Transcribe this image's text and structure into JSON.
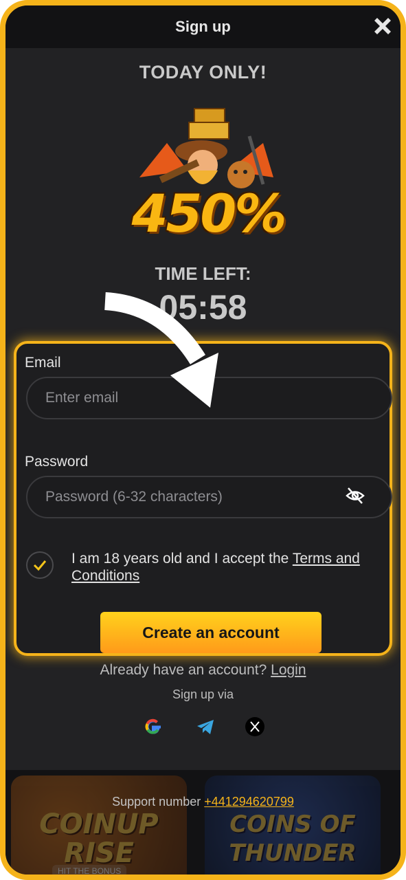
{
  "header": {
    "title": "Sign up",
    "close_icon": "close-icon"
  },
  "promo": {
    "headline": "TODAY ONLY!",
    "bonus_percent": "450%",
    "time_left_label": "TIME LEFT:",
    "countdown": "05:58"
  },
  "form": {
    "email_label": "Email",
    "email_placeholder": "Enter email",
    "password_label": "Password",
    "password_placeholder": "Password (6-32 characters)",
    "password_toggle_icon": "eye-off-icon",
    "agree_checked": true,
    "terms_prefix": "I am 18 years old and I accept the ",
    "terms_link": "Terms and Conditions",
    "create_button": "Create an account"
  },
  "login": {
    "prefix": "Already have an account? ",
    "link": "Login"
  },
  "signup_via": {
    "label": "Sign up via",
    "providers": [
      "google-icon",
      "telegram-icon",
      "x-icon"
    ]
  },
  "footer": {
    "games": [
      {
        "title": "COINUP RISE",
        "subtitle": "HIT THE BONUS"
      },
      {
        "title": "COINS OF THUNDER",
        "subtitle": ""
      }
    ],
    "support_prefix": "Support number ",
    "support_number": "+441294620799"
  },
  "colors": {
    "accent": "#f5b31a",
    "background": "#222224",
    "button_gradient_top": "#ffd21c",
    "button_gradient_bottom": "#ff9a1a"
  }
}
